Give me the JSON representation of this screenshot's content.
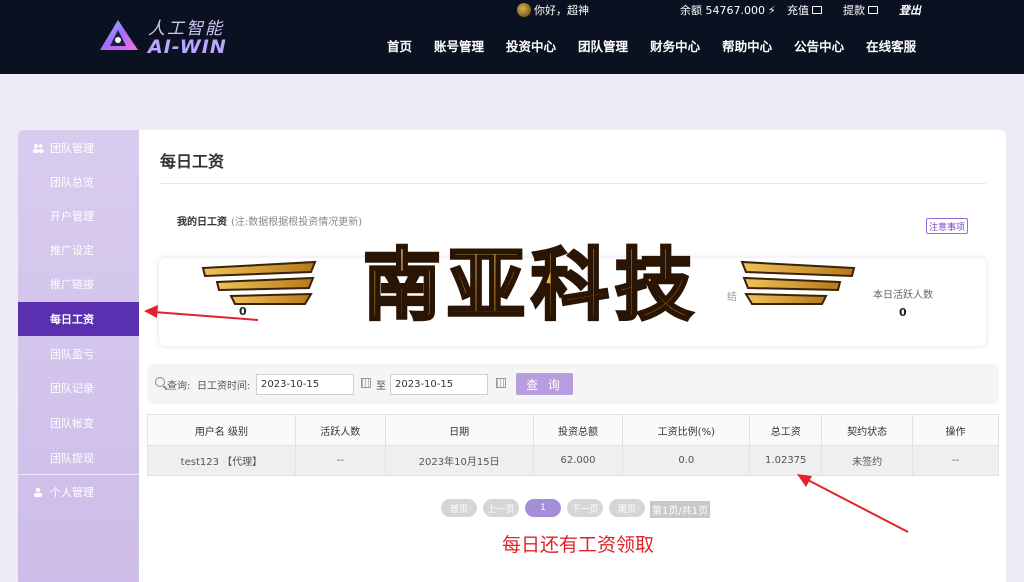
{
  "header": {
    "logo_cn": "人工智能",
    "logo_en": "AI-WIN",
    "greeting": "你好，超神",
    "balance": "余额 54767.000",
    "recharge": "充值",
    "withdraw": "提款",
    "logout": "登出",
    "nav": [
      "首页",
      "账号管理",
      "投资中心",
      "团队管理",
      "财务中心",
      "帮助中心",
      "公告中心",
      "在线客服"
    ]
  },
  "sidebar": {
    "group1": "团队管理",
    "items": [
      "团队总览",
      "开户管理",
      "推广设定",
      "推广链接",
      "每日工资",
      "团队盈亏",
      "团队记录",
      "团队帐变",
      "团队提现"
    ],
    "active_index": 4,
    "group2": "个人管理"
  },
  "main": {
    "title": "每日工资",
    "salary_label": "我的日工资",
    "salary_note": "(注:数据根据根投资情况更新)",
    "notice_button": "注意事项",
    "stats": {
      "left_value": "0",
      "mid_label_fragment": "结",
      "right_label": "本日活跃人数",
      "right_value": "0"
    },
    "watermark_text": "南亚科技",
    "query": {
      "label": "查询:",
      "field_label": "日工资时间:",
      "from": "2023-10-15",
      "to_word": "至",
      "to": "2023-10-15",
      "button": "查 询"
    },
    "table": {
      "headers": [
        "用户名 级别",
        "活跃人数",
        "日期",
        "投资总额",
        "工资比例(%)",
        "总工资",
        "契约状态",
        "操作"
      ],
      "rows": [
        [
          "test123 【代理】",
          "--",
          "2023年10月15日",
          "62.000",
          "0.0",
          "1.02375",
          "未签约",
          "--"
        ]
      ]
    },
    "pager": {
      "first": "首页",
      "prev": "上一页",
      "current": "1",
      "next": "下一页",
      "last": "尾页",
      "info": "第1页/共1页"
    }
  },
  "annotation": {
    "text": "每日还有工资领取",
    "color": "#e0242a"
  },
  "colors": {
    "header_bg": "#0a1120",
    "accent": "#5a2fb0",
    "button": "#b69de0"
  }
}
